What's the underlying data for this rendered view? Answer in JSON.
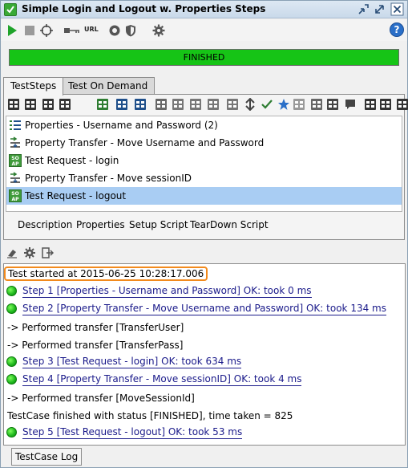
{
  "window": {
    "title": "Simple Login and Logout w. Properties Steps"
  },
  "toolbar": {
    "url_label": "URL",
    "icons": [
      "run-icon",
      "stop-icon",
      "target-icon",
      "key-icon",
      "url-icon",
      "options-icon",
      "security-icon",
      "gear-icon",
      "help-icon"
    ],
    "help_label": "?"
  },
  "progress": {
    "status": "FINISHED",
    "percent": 100,
    "color": "#16c416"
  },
  "tabs": [
    {
      "label": "TestSteps",
      "active": true
    },
    {
      "label": "Test On Demand",
      "active": false
    }
  ],
  "steps": [
    {
      "label": "Properties - Username and Password (2)",
      "icon": "properties-icon",
      "selected": false
    },
    {
      "label": "Property Transfer - Move Username and Password",
      "icon": "transfer-icon",
      "selected": false
    },
    {
      "label": "Test Request - login",
      "icon": "soap-request-icon",
      "selected": false
    },
    {
      "label": "Property Transfer - Move sessionID",
      "icon": "transfer-icon",
      "selected": false
    },
    {
      "label": "Test Request - logout",
      "icon": "soap-request-icon",
      "selected": true
    }
  ],
  "subtabs": [
    "Description",
    "Properties",
    "Setup Script",
    "TearDown Script"
  ],
  "log": {
    "started": "Test started at 2015-06-25 10:28:17.006",
    "lines": [
      {
        "kind": "step",
        "text": "Step 1 [Properties - Username and Password] OK: took 0 ms"
      },
      {
        "kind": "step",
        "text": "Step 2 [Property Transfer - Move Username and Password] OK: took 134 ms"
      },
      {
        "kind": "text",
        "text": "-> Performed transfer [TransferUser]"
      },
      {
        "kind": "text",
        "text": "-> Performed transfer [TransferPass]"
      },
      {
        "kind": "step",
        "text": "Step 3 [Test Request - login] OK: took 634 ms"
      },
      {
        "kind": "step",
        "text": "Step 4 [Property Transfer - Move sessionID] OK: took 4 ms"
      },
      {
        "kind": "text",
        "text": "-> Performed transfer [MoveSessionId]"
      },
      {
        "kind": "text",
        "text": "TestCase finished with status [FINISHED], time taken = 825"
      },
      {
        "kind": "step",
        "text": "Step 5 [Test Request - logout] OK: took 53 ms"
      }
    ]
  },
  "bottom_tab": "TestCase Log",
  "colors": {
    "accent_orange": "#f28a1c",
    "selection": "#a9cdf3",
    "ok_green": "#1bb31b"
  }
}
